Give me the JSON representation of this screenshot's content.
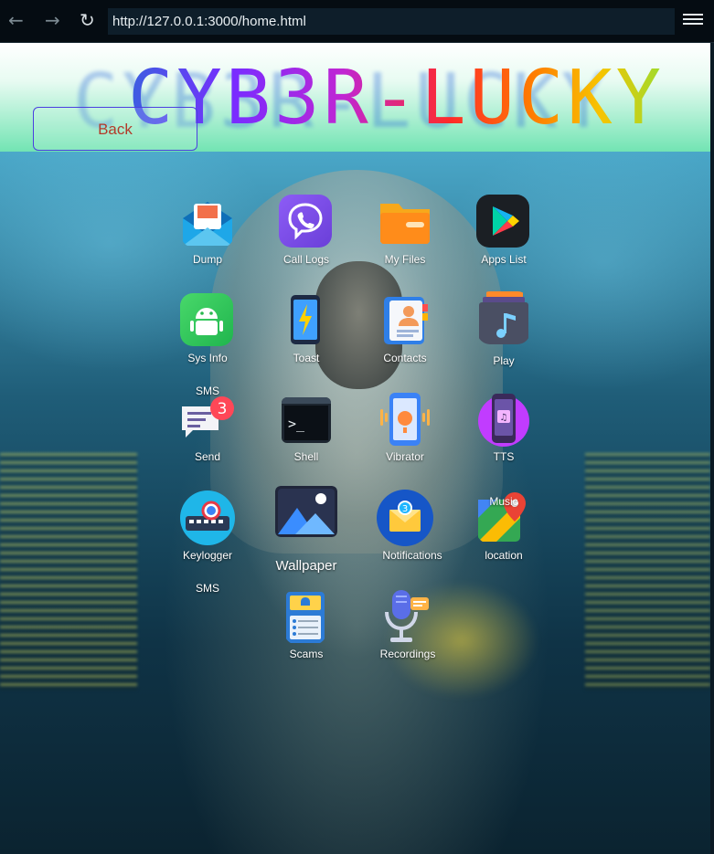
{
  "browser": {
    "url": "http://127.0.0.1:3000/home.html",
    "back_icon": "arrow-left-icon",
    "forward_icon": "arrow-right-icon",
    "reload_icon": "reload-icon",
    "menu_icon": "hamburger-menu-icon"
  },
  "header": {
    "logo_text": "CYB3R-LUCKY",
    "back_label": "Back"
  },
  "apps": {
    "dump": "Dump",
    "call_logs": "Call Logs",
    "my_files": "My Files",
    "apps_list": "Apps List",
    "sys_info": "Sys Info",
    "toast": "Toast",
    "contacts": "Contacts",
    "play": "Play",
    "sms_top": "SMS",
    "send": "Send",
    "send_badge": "3",
    "shell": "Shell",
    "vibrator": "Vibrator",
    "tts": "TTS",
    "keylogger": "Keylogger",
    "wallpaper": "Wallpaper",
    "notifications": "Notifications",
    "notifications_badge": "3",
    "music": "Music",
    "location": "location",
    "sms_bottom": "SMS",
    "scams": "Scams",
    "recordings": "Recordings"
  }
}
